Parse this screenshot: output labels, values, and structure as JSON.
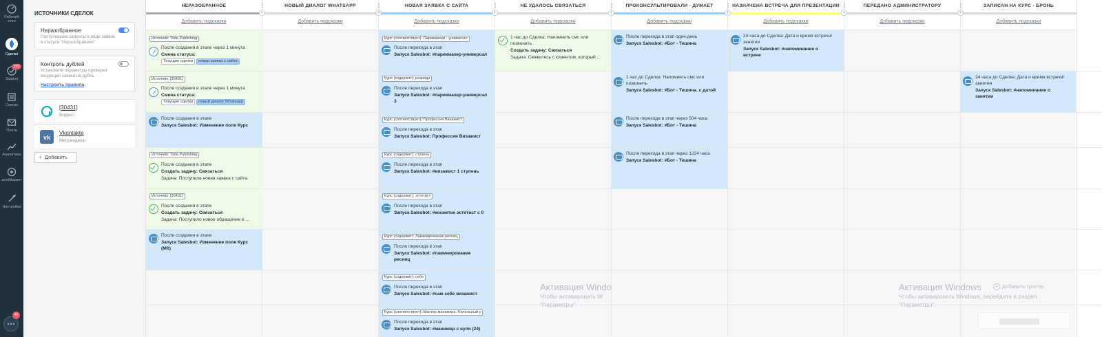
{
  "nav": {
    "items": [
      {
        "label": "Рабочий стол",
        "icon": "dashboard-icon"
      },
      {
        "label": "Сделки",
        "icon": "deals-icon",
        "active": true
      },
      {
        "label": "Задачи",
        "icon": "tasks-icon",
        "badge": "226"
      },
      {
        "label": "Списки",
        "icon": "lists-icon"
      },
      {
        "label": "Почта",
        "icon": "mail-icon"
      },
      {
        "label": "Аналитика",
        "icon": "analytics-icon"
      },
      {
        "label": "amoМаркет",
        "icon": "market-icon"
      },
      {
        "label": "Настройки",
        "icon": "settings-icon"
      }
    ],
    "chat_badge": "40"
  },
  "sources": {
    "title": "ИСТОЧНИКИ СДЕЛОК",
    "unsorted": {
      "title": "Неразобранное",
      "desc": "Поступившие запросы в виде заявок в статусе \"Неразобранное\"",
      "enabled": true
    },
    "duplicates": {
      "title": "Контроль дублей",
      "desc": "Установите параметры проверки входящей заявки на дубль",
      "link": "Настроить правила",
      "enabled": false
    },
    "widgets": [
      {
        "name": "[30431]",
        "sub": "Виджет",
        "icon": "amo-widget-icon"
      },
      {
        "name": "Vkontakte",
        "sub": "Мессенджер",
        "icon": "vk-icon"
      }
    ],
    "add_label": "Добавить"
  },
  "board": {
    "hint_label": "Добавить подсказки",
    "columns": [
      {
        "title": "НЕРАЗОБРАННОЕ",
        "color": "#a7acb2"
      },
      {
        "title": "НОВЫЙ ДИАЛОГ WHATSAPP",
        "color": "#d6dadd"
      },
      {
        "title": "НОВАЯ ЗАЯВКА С САЙТА",
        "color": "#99ccff"
      },
      {
        "title": "НЕ УДАЛОСЬ СВЯЗАТЬСЯ",
        "color": "#d6dadd"
      },
      {
        "title": "ПРОКОНСУЛЬТИРОВАЛИ - ДУМАЕТ",
        "color": "#99ccff"
      },
      {
        "title": "НАЗНАЧЕНА ВСТРЕЧА ДЛЯ ПРЕЗЕНТАЦИИ",
        "color": "#fffd7f"
      },
      {
        "title": "ПЕРЕДАНО АДМИНИСТРАТОРУ",
        "color": "#d6dadd"
      },
      {
        "title": "ЗАПИСАН НА КУРС - БРОНЬ",
        "color": "#d6dadd"
      }
    ]
  },
  "cells": {
    "c0r0": {
      "tag": "Источник: Tilda Publishing",
      "l1": "После создания в этапе через 1 минута",
      "l2": "Смена статуса:",
      "chip1": "Текущие сделки",
      "chip2": "новая заявка с сайта"
    },
    "c0r1": {
      "tag": "Источник: [30431]",
      "l1": "После создания в этапе через 1 минута",
      "l2": "Смена статуса:",
      "chip1": "Текущие сделки",
      "chip2": "новый диалог Whatsapp"
    },
    "c0r2": {
      "l1": "После создания в этапе",
      "l2": "Запуск Salesbot: Изменение поля Курс"
    },
    "c0r3": {
      "tag": "Источник: Tilda Publishing",
      "l1": "После создания в этапе",
      "l2": "Создать задачу: Связаться",
      "l3": "Задача: Поступила новая заявка с сайта."
    },
    "c0r4": {
      "tag": "Источник: [30431]",
      "l1": "После создания в этапе",
      "l2": "Создать задачу: Связаться",
      "l3": "Задача: Поступило новое обращение в ..."
    },
    "c0r5": {
      "l1": "После создания в этапе",
      "l2": "Запуск Salesbot: Изменение поля Курс",
      "l2b": "(МК)"
    },
    "c2r0": {
      "tag": "Курс (соответствует): Парикмахер - универсал",
      "l1": "После перехода в этап",
      "l2": "Запуск Salesbot: #парикмахер-универсал"
    },
    "c2r1": {
      "tag": "Курс (содержит): разряда",
      "l1": "После перехода в этап",
      "l2": "Запуск Salesbot: #парикмахер-универсал",
      "l2b": "3"
    },
    "c2r2": {
      "tag": "Курс (соответствует): Профессия Визажист",
      "l1": "После перехода в этап",
      "l2": "Запуск Salesbot: Профессия Визажист"
    },
    "c2r3": {
      "tag": "Курс (содержит): ступень",
      "l1": "После перехода в этап",
      "l2": "Запуск Salesbot: #визажист 1 ступень"
    },
    "c2r4": {
      "tag": "Курс (содержит): эстетист",
      "l1": "После перехода в этап",
      "l2": "Запуск Salesbot: #косметик эстетист с 0"
    },
    "c2r5": {
      "tag": "Курс (содержит): Ламинирование ресниц",
      "l1": "После перехода в этап",
      "l2": "Запуск Salesbot: #ламинирование",
      "l2b": "ресниц"
    },
    "c2r6": {
      "tag": "Курс (содержит): себе",
      "l1": "После перехода в этап",
      "l2": "Запуск Salesbot: #сам себе визажист"
    },
    "c2r7": {
      "tag": "Курс (соответствует): Мастер маникюра. Начальный у",
      "l1": "После перехода в этап",
      "l2": "Запуск Salesbot: #маникюр с нуля (24)"
    },
    "c3r0": {
      "l1": "1 час до Сделка: Напомнить смс или",
      "l1b": "позвонить",
      "l2": "Создать задачу: Связаться",
      "l3": "Задача: Свяжитесь с клиентом, который ..."
    },
    "c4r0": {
      "l1": "После перехода в этап один день",
      "l2": "Запуск Salesbot: #Бот - Тишина"
    },
    "c4r1": {
      "l1": "1 час до Сделка: Напомнить смс или",
      "l1b": "позвонить",
      "l2": "Запуск Salesbot: #Бот - Тишина_с датой"
    },
    "c4r2": {
      "l1": "После перехода в этап через 504 часа",
      "l2": "Запуск Salesbot: #Бот - Тишина"
    },
    "c4r3": {
      "l1": "После перехода в этап через 1224 часа",
      "l2": "Запуск Salesbot: #Бот - Тишина"
    },
    "c5r0": {
      "l1": "24 часа до Сделка: Дата и время встречи/",
      "l1b": "занятия",
      "l2": "Запуск Salesbot: #напоминание о",
      "l2b": "встрече"
    },
    "c7r1": {
      "l1": "24 часа до Сделка: Дата и время встречи/",
      "l1b": "занятия",
      "l2": "Запуск Salesbot: #напоминание о",
      "l2b": "занятии"
    }
  },
  "watermark": {
    "title": "Активация Windows",
    "title_short": "Активация Windo",
    "line1": "Чтобы активировать Windows, перейдите в раздел",
    "line1_short": "Чтобы активировать W",
    "line2": "\"Параметры\".",
    "line2_short": "\"Параметры\".",
    "trigger_label": "Добавить триггер"
  },
  "colors": {
    "nav_bg": "#21323f",
    "accent_blue": "#d3e8fa",
    "accent_green": "#effbe8",
    "bot_icon": "#4a8ec8",
    "task_icon": "#4ab84a"
  }
}
